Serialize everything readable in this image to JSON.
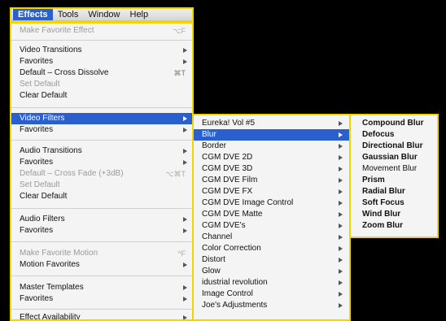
{
  "menubar": {
    "items": [
      "Effects",
      "Tools",
      "Window",
      "Help"
    ]
  },
  "effects_menu": {
    "make_favorite_effect": "Make Favorite Effect",
    "make_favorite_effect_shortcut": "⌥F",
    "video_transitions": "Video Transitions",
    "favorites_1": "Favorites",
    "default_cross_dissolve": "Default – Cross Dissolve",
    "default_cross_dissolve_shortcut": "⌘T",
    "set_default_1": "Set Default",
    "clear_default_1": "Clear Default",
    "video_filters": "Video Filters",
    "favorites_2": "Favorites",
    "audio_transitions": "Audio Transitions",
    "favorites_3": "Favorites",
    "default_cross_fade": "Default – Cross Fade (+3dB)",
    "default_cross_fade_shortcut": "⌥⌘T",
    "set_default_2": "Set Default",
    "clear_default_2": "Clear Default",
    "audio_filters": "Audio Filters",
    "favorites_4": "Favorites",
    "make_favorite_motion": "Make Favorite Motion",
    "make_favorite_motion_shortcut": "^F",
    "motion_favorites": "Motion Favorites",
    "master_templates": "Master Templates",
    "favorites_5": "Favorites",
    "effect_availability": "Effect Availability"
  },
  "video_filters_menu": [
    "Eureka! Vol #5",
    "Blur",
    "Border",
    "CGM DVE 2D",
    "CGM DVE 3D",
    "CGM DVE Film",
    "CGM DVE FX",
    "CGM DVE Image Control",
    "CGM DVE Matte",
    "CGM DVE's",
    "Channel",
    "Color Correction",
    "Distort",
    "Glow",
    "idustrial revolution",
    "Image Control",
    "Joe's Adjustments"
  ],
  "blur_menu": [
    "Compound Blur",
    "Defocus",
    "Directional Blur",
    "Gaussian Blur",
    "Movement Blur",
    "Prism",
    "Radial Blur",
    "Soft Focus",
    "Wind Blur",
    "Zoom Blur"
  ],
  "colors": {
    "highlight": "#2a5fd0",
    "border": "#f2d400",
    "background": "#000000"
  }
}
